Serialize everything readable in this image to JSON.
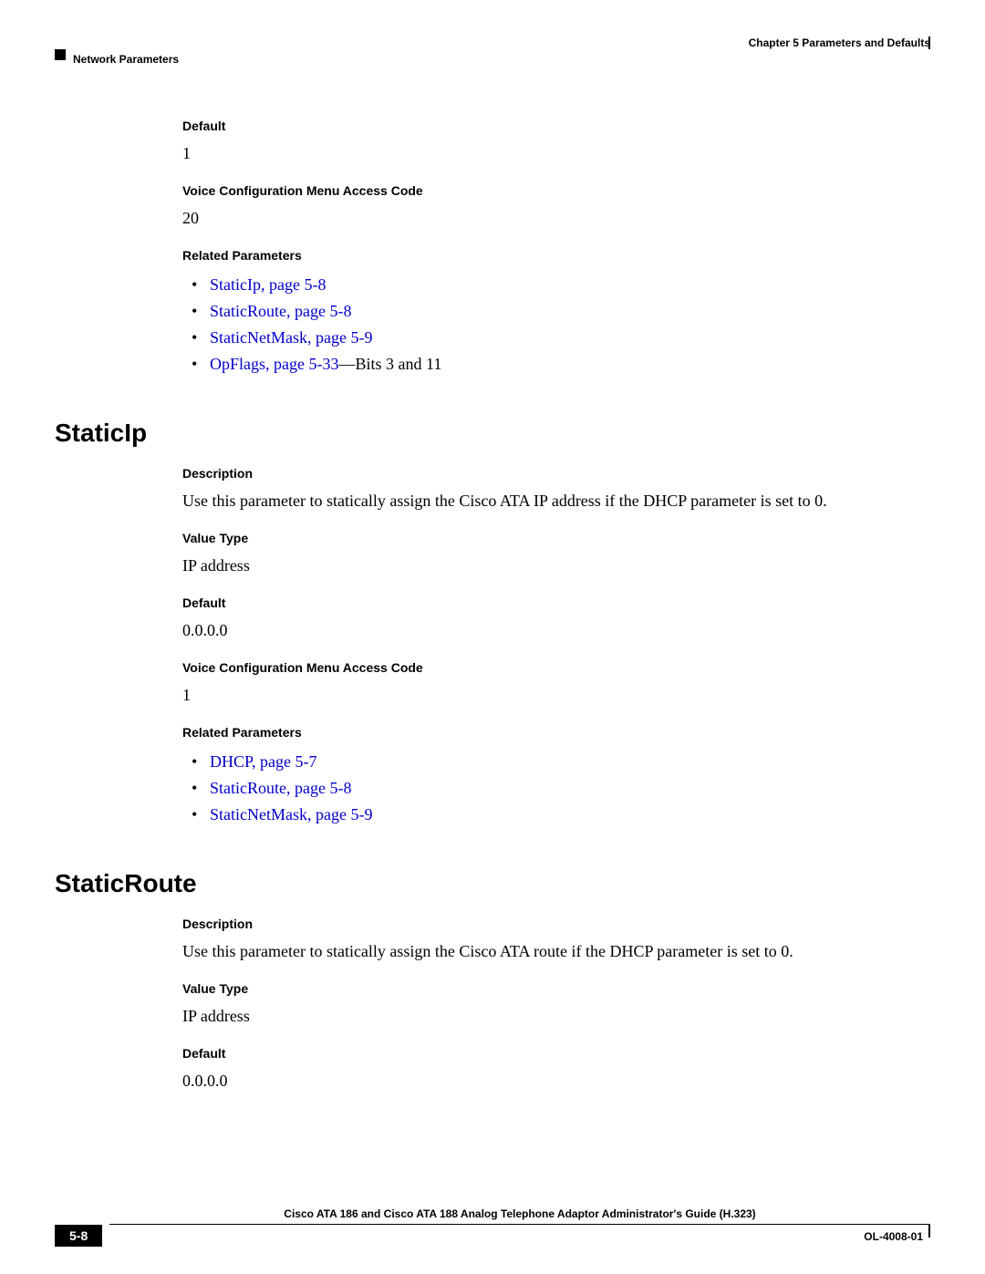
{
  "header": {
    "chapter": "Chapter 5    Parameters and Defaults",
    "section": "Network Parameters"
  },
  "block1": {
    "default_label": "Default",
    "default_value": "1",
    "vcmac_label": "Voice Configuration Menu Access Code",
    "vcmac_value": "20",
    "related_label": "Related Parameters",
    "links": {
      "l1": "StaticIp, page 5-8",
      "l2": "StaticRoute, page 5-8",
      "l3": "StaticNetMask, page 5-9",
      "l4_link": "OpFlags, page 5-33",
      "l4_tail": "—Bits 3 and 11"
    }
  },
  "staticip": {
    "heading": "StaticIp",
    "desc_label": "Description",
    "desc_text": "Use this parameter to statically assign the Cisco ATA IP address if the DHCP parameter is set to 0.",
    "vt_label": "Value Type",
    "vt_value": "IP address",
    "default_label": "Default",
    "default_value": "0.0.0.0",
    "vcmac_label": "Voice Configuration Menu Access Code",
    "vcmac_value": "1",
    "related_label": "Related Parameters",
    "links": {
      "l1": "DHCP, page 5-7",
      "l2": "StaticRoute, page 5-8",
      "l3": "StaticNetMask, page 5-9"
    }
  },
  "staticroute": {
    "heading": "StaticRoute",
    "desc_label": "Description",
    "desc_text": "Use this parameter to statically assign the Cisco ATA route if the DHCP parameter is set to 0.",
    "vt_label": "Value Type",
    "vt_value": "IP address",
    "default_label": "Default",
    "default_value": "0.0.0.0"
  },
  "footer": {
    "title": "Cisco ATA 186 and Cisco ATA 188 Analog Telephone Adaptor Administrator's Guide (H.323)",
    "page": "5-8",
    "docnum": "OL-4008-01"
  }
}
